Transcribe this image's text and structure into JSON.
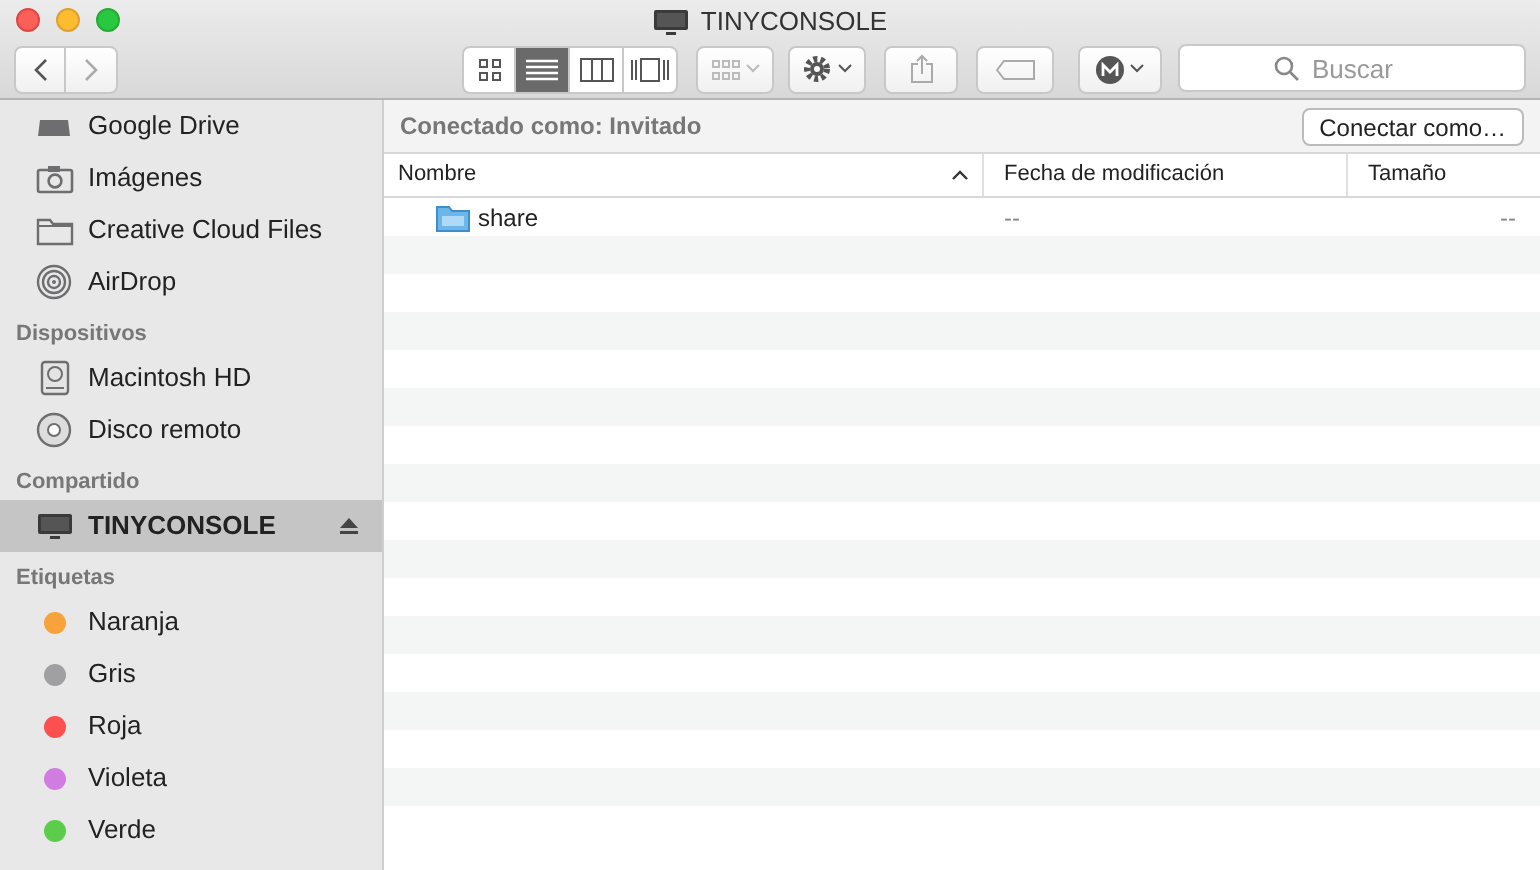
{
  "window": {
    "title": "TINYCONSOLE"
  },
  "toolbar": {
    "views": [
      {
        "kind": "icons",
        "selected": false
      },
      {
        "kind": "list",
        "selected": true
      },
      {
        "kind": "columns",
        "selected": false
      },
      {
        "kind": "coverflow",
        "selected": false
      }
    ],
    "search": {
      "placeholder": "Buscar"
    }
  },
  "sidebar": {
    "sections": [
      {
        "items": [
          {
            "label": "Google Drive",
            "kind": "drive",
            "selected": false
          },
          {
            "label": "Imágenes",
            "kind": "camera",
            "selected": false
          },
          {
            "label": "Creative Cloud Files",
            "kind": "folder",
            "selected": false
          },
          {
            "label": "AirDrop",
            "kind": "airdrop",
            "selected": false
          }
        ]
      },
      {
        "title": "Dispositivos",
        "items": [
          {
            "label": "Macintosh HD",
            "kind": "disk",
            "selected": false
          },
          {
            "label": "Disco remoto",
            "kind": "cd",
            "selected": false
          }
        ]
      },
      {
        "title": "Compartido",
        "items": [
          {
            "label": "TINYCONSOLE",
            "kind": "computer",
            "selected": true,
            "eject": true
          }
        ]
      },
      {
        "title": "Etiquetas",
        "items": [
          {
            "label": "Naranja",
            "kind": "tag",
            "color": "#f7a23b",
            "selected": false
          },
          {
            "label": "Gris",
            "kind": "tag",
            "color": "#a0a0a2",
            "selected": false
          },
          {
            "label": "Roja",
            "kind": "tag",
            "color": "#fc4f4f",
            "selected": false
          },
          {
            "label": "Violeta",
            "kind": "tag",
            "color": "#d07ce0",
            "selected": false
          },
          {
            "label": "Verde",
            "kind": "tag",
            "color": "#5ccd4a",
            "selected": false
          }
        ]
      }
    ]
  },
  "connection": {
    "status": "Conectado como: Invitado",
    "button": "Conectar como…"
  },
  "table": {
    "columns": [
      "Nombre",
      "Fecha de modificación",
      "Tamaño"
    ],
    "rows": [
      {
        "name": "share",
        "date": "--",
        "size": "--"
      }
    ]
  }
}
